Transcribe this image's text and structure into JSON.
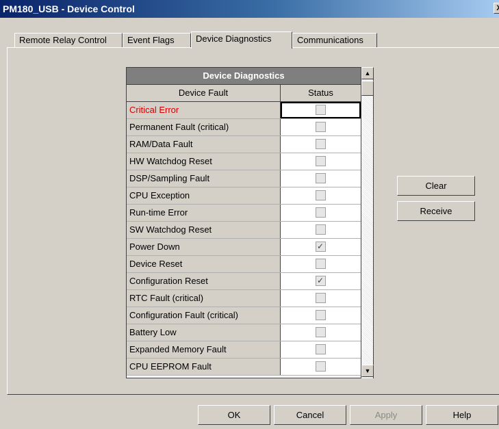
{
  "window": {
    "title": "PM180_USB - Device Control",
    "close_glyph": "X"
  },
  "tabs": [
    {
      "label": "Remote Relay Control"
    },
    {
      "label": "Event Flags"
    },
    {
      "label": "Device Diagnostics"
    },
    {
      "label": "Communications"
    }
  ],
  "diagnostics": {
    "title": "Device Diagnostics",
    "col_fault": "Device Fault",
    "col_status": "Status",
    "rows": [
      {
        "fault": "Critical Error",
        "checked": false
      },
      {
        "fault": "Permanent Fault (critical)",
        "checked": false
      },
      {
        "fault": "RAM/Data Fault",
        "checked": false
      },
      {
        "fault": "HW Watchdog Reset",
        "checked": false
      },
      {
        "fault": "DSP/Sampling Fault",
        "checked": false
      },
      {
        "fault": "CPU Exception",
        "checked": false
      },
      {
        "fault": "Run-time Error",
        "checked": false
      },
      {
        "fault": "SW Watchdog Reset",
        "checked": false
      },
      {
        "fault": "Power Down",
        "checked": true
      },
      {
        "fault": "Device Reset",
        "checked": false
      },
      {
        "fault": "Configuration Reset",
        "checked": true
      },
      {
        "fault": "RTC Fault (critical)",
        "checked": false
      },
      {
        "fault": "Configuration Fault (critical)",
        "checked": false
      },
      {
        "fault": "Battery Low",
        "checked": false
      },
      {
        "fault": "Expanded Memory Fault",
        "checked": false
      },
      {
        "fault": "CPU EEPROM Fault",
        "checked": false
      }
    ]
  },
  "side_buttons": {
    "clear": "Clear",
    "receive": "Receive"
  },
  "footer": {
    "ok": "OK",
    "cancel": "Cancel",
    "apply": "Apply",
    "help": "Help"
  },
  "colors": {
    "title_bar": "#0a246a",
    "dialog_bg": "#d4d0c8",
    "error_text": "#d00000",
    "header_bg": "#7f7f7f"
  }
}
